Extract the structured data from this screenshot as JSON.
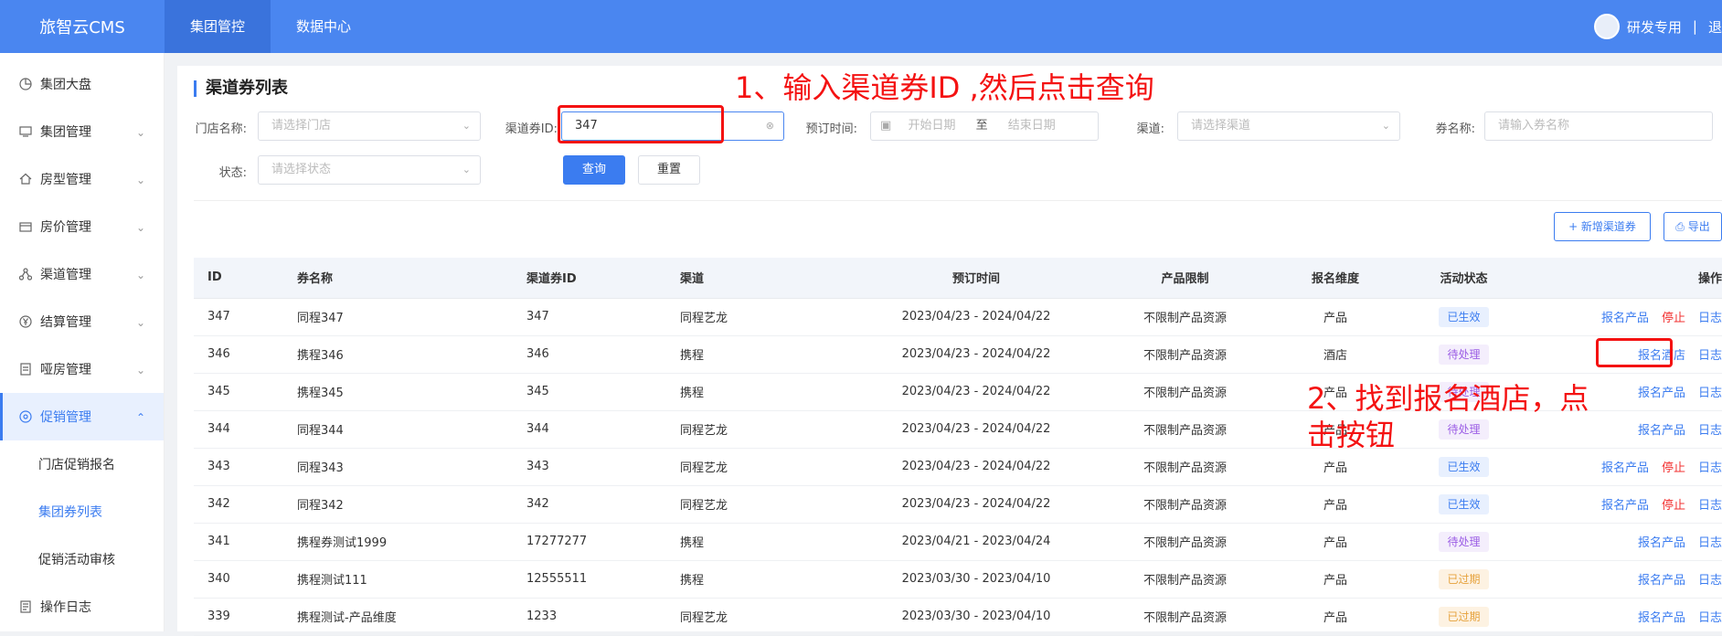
{
  "app": {
    "title": "旅智云CMS"
  },
  "topnav": {
    "tabs": [
      {
        "label": "集团管控"
      },
      {
        "label": "数据中心"
      }
    ]
  },
  "user": {
    "name": "研发专用",
    "sep": "|",
    "logout": "退"
  },
  "sidebar": {
    "items": [
      {
        "label": "集团大盘",
        "icon": "dashboard-icon"
      },
      {
        "label": "集团管理",
        "icon": "monitor-icon"
      },
      {
        "label": "房型管理",
        "icon": "home-icon"
      },
      {
        "label": "房价管理",
        "icon": "card-icon"
      },
      {
        "label": "渠道管理",
        "icon": "share-icon"
      },
      {
        "label": "结算管理",
        "icon": "yen-icon"
      },
      {
        "label": "哑房管理",
        "icon": "document-icon"
      },
      {
        "label": "促销管理",
        "icon": "promotion-icon"
      }
    ],
    "sub_items": [
      {
        "label": "门店促销报名"
      },
      {
        "label": "集团券列表"
      },
      {
        "label": "促销活动审核"
      }
    ],
    "footer_item": {
      "label": "操作日志",
      "icon": "log-icon"
    }
  },
  "page": {
    "title": "渠道券列表"
  },
  "filters": {
    "store_label": "门店名称:",
    "store_placeholder": "请选择门店",
    "coupon_id_label": "渠道券ID:",
    "coupon_id_value": "347",
    "booking_label": "预订时间:",
    "start_placeholder": "开始日期",
    "range_sep": "至",
    "end_placeholder": "结束日期",
    "channel_label": "渠道:",
    "channel_placeholder": "请选择渠道",
    "name_label": "券名称:",
    "name_placeholder": "请输入券名称",
    "status_label": "状态:",
    "status_placeholder": "请选择状态",
    "query_btn": "查询",
    "reset_btn": "重置"
  },
  "toolbar": {
    "add_btn": "+ 新增渠道券",
    "export_btn": "导出"
  },
  "table": {
    "columns": [
      "ID",
      "券名称",
      "渠道券ID",
      "渠道",
      "预订时间",
      "产品限制",
      "报名维度",
      "活动状态",
      "操作"
    ],
    "rows": [
      {
        "id": "347",
        "name": "同程347",
        "cid": "347",
        "channel": "同程艺龙",
        "time": "2023/04/23 - 2024/04/22",
        "limit": "不限制产品资源",
        "dim": "产品",
        "status": "已生效",
        "status_color": "blue",
        "ops": [
          "报名产品",
          "停止",
          "日志"
        ]
      },
      {
        "id": "346",
        "name": "携程346",
        "cid": "346",
        "channel": "携程",
        "time": "2023/04/23 - 2024/04/22",
        "limit": "不限制产品资源",
        "dim": "酒店",
        "status": "待处理",
        "status_color": "purple",
        "ops": [
          "报名酒店",
          "日志"
        ]
      },
      {
        "id": "345",
        "name": "携程345",
        "cid": "345",
        "channel": "携程",
        "time": "2023/04/23 - 2024/04/22",
        "limit": "不限制产品资源",
        "dim": "产品",
        "status": "待处理",
        "status_color": "purple",
        "ops": [
          "报名产品",
          "日志"
        ]
      },
      {
        "id": "344",
        "name": "同程344",
        "cid": "344",
        "channel": "同程艺龙",
        "time": "2023/04/23 - 2024/04/22",
        "limit": "不限制产品资源",
        "dim": "产品",
        "status": "待处理",
        "status_color": "purple",
        "ops": [
          "报名产品",
          "日志"
        ]
      },
      {
        "id": "343",
        "name": "同程343",
        "cid": "343",
        "channel": "同程艺龙",
        "time": "2023/04/23 - 2024/04/22",
        "limit": "不限制产品资源",
        "dim": "产品",
        "status": "已生效",
        "status_color": "blue",
        "ops": [
          "报名产品",
          "停止",
          "日志"
        ]
      },
      {
        "id": "342",
        "name": "同程342",
        "cid": "342",
        "channel": "同程艺龙",
        "time": "2023/04/23 - 2024/04/22",
        "limit": "不限制产品资源",
        "dim": "产品",
        "status": "已生效",
        "status_color": "blue",
        "ops": [
          "报名产品",
          "停止",
          "日志"
        ]
      },
      {
        "id": "341",
        "name": "携程券测试1999",
        "cid": "17277277",
        "channel": "携程",
        "time": "2023/04/21 - 2023/04/24",
        "limit": "不限制产品资源",
        "dim": "产品",
        "status": "待处理",
        "status_color": "purple",
        "ops": [
          "报名产品",
          "日志"
        ]
      },
      {
        "id": "340",
        "name": "携程测试111",
        "cid": "12555511",
        "channel": "携程",
        "time": "2023/03/30 - 2023/04/10",
        "limit": "不限制产品资源",
        "dim": "产品",
        "status": "已过期",
        "status_color": "orange",
        "ops": [
          "报名产品",
          "日志"
        ]
      },
      {
        "id": "339",
        "name": "携程测试-产品维度",
        "cid": "1233",
        "channel": "同程艺龙",
        "time": "2023/03/30 - 2023/04/10",
        "limit": "不限制产品资源",
        "dim": "产品",
        "status": "已过期",
        "status_color": "orange",
        "ops": [
          "报名产品",
          "日志"
        ]
      }
    ]
  },
  "annotations": {
    "step1": "1、输入渠道券ID ,然后点击查询",
    "step2_line1": "2、找到报名酒店，点",
    "step2_line2": "击按钮"
  },
  "colors": {
    "primary": "#3b7cf0",
    "topbar": "#4a86f0",
    "annotation": "#f41212"
  }
}
